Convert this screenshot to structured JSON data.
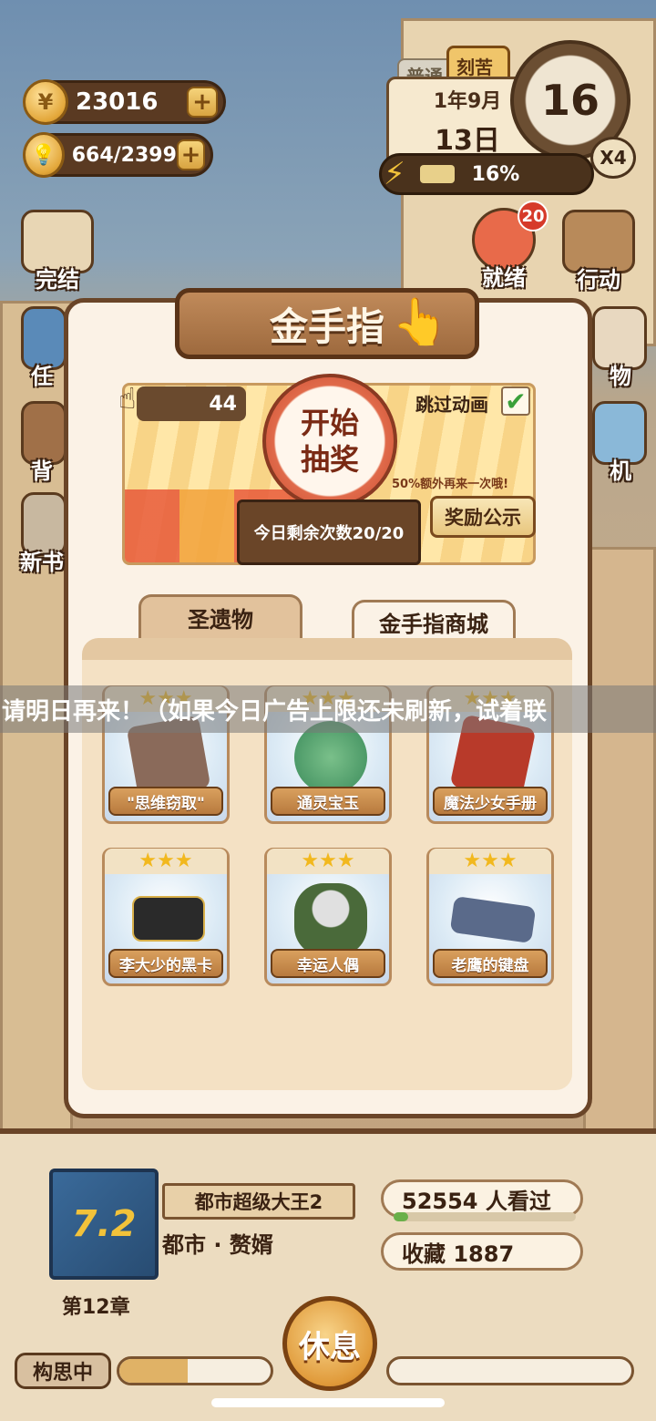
{
  "resources": {
    "coins": "23016",
    "inspiration": "664/2399",
    "coin_symbol": "¥",
    "plus": "+"
  },
  "calendar": {
    "mode_normal": "普通",
    "mode_hard": "刻苦",
    "year_month": "1年9月",
    "day": "13日",
    "clock_value": "16",
    "speed": "X4",
    "energy_percent": "16%",
    "energy_fraction": 0.16
  },
  "side_buttons": {
    "finish": "完结",
    "task": "任",
    "bag": "背",
    "new_book": "新书",
    "ready": "就绪",
    "ready_badge": "20",
    "action": "行动",
    "shop": "物",
    "phone": "机"
  },
  "modal": {
    "title": "金手指",
    "tickets": "44",
    "draw_line1": "开始",
    "draw_line2": "抽奖",
    "skip_animation": "跳过动画",
    "skip_checked": "✔",
    "bonus_chance": "50%额外再来一次哦!",
    "reward_button": "奖励公示",
    "remaining": "今日剩余次数20/20",
    "tabs": [
      "圣遗物",
      "金手指商城"
    ],
    "items": [
      {
        "name": "\"思维窃取\"",
        "stars": "★★★",
        "art": "card-icon"
      },
      {
        "name": "通灵宝玉",
        "stars": "★★★",
        "art": "jade-icon"
      },
      {
        "name": "魔法少女手册",
        "stars": "★★★",
        "art": "book-icon"
      },
      {
        "name": "李大少的黑卡",
        "stars": "★★★",
        "art": "vip-card-icon"
      },
      {
        "name": "幸运人偶",
        "stars": "★★★",
        "art": "doll-icon"
      },
      {
        "name": "老鹰的键盘",
        "stars": "★★★",
        "art": "keyboard-icon"
      }
    ]
  },
  "toast": "请明日再来！（如果今日广告上限还未刷新，试着联",
  "novel": {
    "rating": "7.2",
    "chapter": "第12章",
    "title": "都市超级大王2",
    "genre": "都市 · 赘婿",
    "views": "52554  人看过",
    "favorites": "收藏 1887",
    "views_fraction": 0.08
  },
  "footer": {
    "state": "构思中",
    "rest_button": "休息",
    "left_progress": 0.45,
    "right_progress": 0.0
  },
  "colors": {
    "accent_brown": "#6a4528",
    "gold": "#f2b81e",
    "panel_bg": "#fbf2e6"
  }
}
